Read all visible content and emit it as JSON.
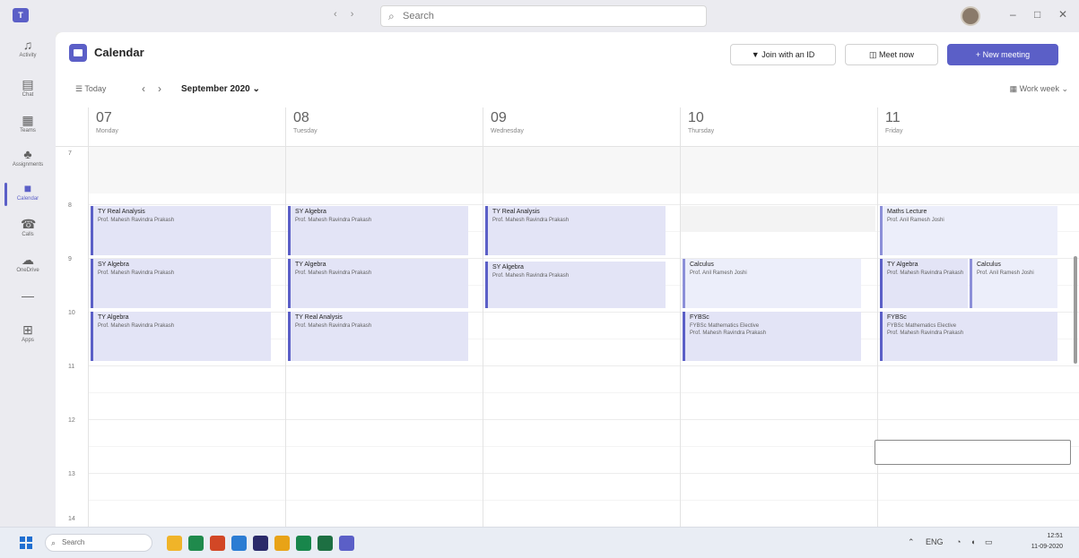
{
  "titlebar": {
    "search_placeholder": "Search"
  },
  "rail": [
    {
      "icon": "bell-icon",
      "label": "Activity"
    },
    {
      "icon": "chat-icon",
      "label": "Chat"
    },
    {
      "icon": "teams-icon",
      "label": "Teams"
    },
    {
      "icon": "assignments-icon",
      "label": "Assignments"
    },
    {
      "icon": "calendar-icon",
      "label": "Calendar",
      "active": true
    },
    {
      "icon": "phone-icon",
      "label": "Calls"
    },
    {
      "icon": "cloud-icon",
      "label": "OneDrive"
    },
    {
      "icon": "more-icon",
      "label": "..."
    },
    {
      "icon": "apps-icon",
      "label": "Apps"
    }
  ],
  "header": {
    "title": "Calendar",
    "join_label": "Join with an ID",
    "meet_label": "Meet now",
    "new_meeting_label": "+ New meeting"
  },
  "toolbar": {
    "today_label": "Today",
    "month_label": "September 2020",
    "view_label": "Work week"
  },
  "days": [
    {
      "num": "07",
      "name": "Monday"
    },
    {
      "num": "08",
      "name": "Tuesday"
    },
    {
      "num": "09",
      "name": "Wednesday"
    },
    {
      "num": "10",
      "name": "Thursday"
    },
    {
      "num": "11",
      "name": "Friday"
    }
  ],
  "hours": [
    "7",
    "8",
    "9",
    "10",
    "11",
    "12",
    "13",
    "14"
  ],
  "events": {
    "mon_1": {
      "title": "TY Real Analysis",
      "sub": "Prof. Mahesh Ravindra Prakash"
    },
    "mon_2": {
      "title": "SY Algebra",
      "sub": "Prof. Mahesh Ravindra Prakash"
    },
    "mon_3": {
      "title": "TY Algebra",
      "sub": "Prof. Mahesh Ravindra Prakash"
    },
    "tue_1": {
      "title": "SY Algebra",
      "sub": "Prof. Mahesh Ravindra Prakash"
    },
    "tue_2": {
      "title": "TY Algebra",
      "sub": "Prof. Mahesh Ravindra Prakash"
    },
    "tue_3": {
      "title": "TY Real Analysis",
      "sub": "Prof. Mahesh Ravindra Prakash"
    },
    "wed_1": {
      "title": "TY Real Analysis",
      "sub": "Prof. Mahesh Ravindra Prakash"
    },
    "wed_2": {
      "title": "SY Algebra",
      "sub": "Prof. Mahesh Ravindra Prakash"
    },
    "thu_1": {
      "title": "Calculus",
      "sub": "Prof. Anil Ramesh Joshi"
    },
    "thu_2": {
      "title": "FYBSc",
      "sub": "FYBSc Mathematics Elective",
      "sub2": "Prof. Mahesh Ravindra Prakash"
    },
    "fri_1": {
      "title": "Maths Lecture",
      "sub": "Prof. Anil Ramesh Joshi"
    },
    "fri_2": {
      "title": "TY Algebra",
      "sub": "Prof. Mahesh Ravindra Prakash"
    },
    "fri_3": {
      "title": "Calculus",
      "sub": "Prof. Anil Ramesh Joshi"
    },
    "fri_4": {
      "title": "FYBSc",
      "sub": "FYBSc Mathematics Elective",
      "sub2": "Prof. Mahesh Ravindra Prakash"
    }
  },
  "taskbar": {
    "search_label": "Search",
    "time": "12:51",
    "date": "11-09-2020"
  }
}
